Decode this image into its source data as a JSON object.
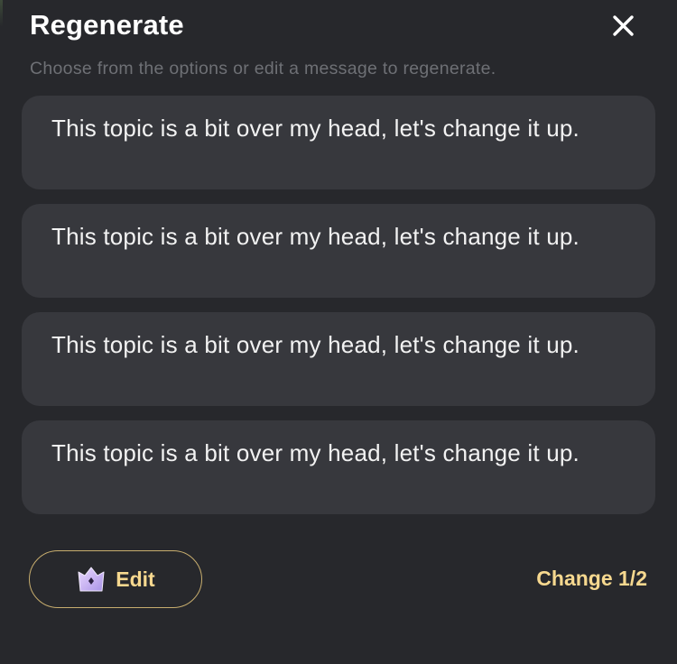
{
  "dialog": {
    "title": "Regenerate",
    "subtitle": "Choose from the options or edit a message to regenerate.",
    "close_icon": "close-icon"
  },
  "options": [
    {
      "text": "This topic is a bit over my head, let's change it up."
    },
    {
      "text": "This topic is a bit over my head, let's change it up."
    },
    {
      "text": "This topic is a bit over my head, let's change it up."
    },
    {
      "text": "This topic is a bit over my head, let's change it up."
    }
  ],
  "footer": {
    "edit_label": "Edit",
    "edit_icon": "crown-icon",
    "change_label": "Change 1/2"
  },
  "colors": {
    "background": "#27282c",
    "card": "#37383d",
    "accent": "#f6d88f",
    "muted_text": "#6e7075"
  }
}
